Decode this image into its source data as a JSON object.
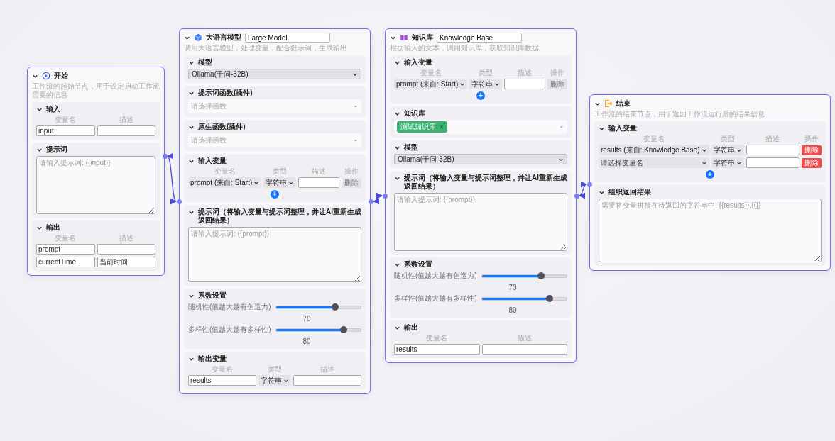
{
  "nodes": [
    {
      "kind": "start",
      "title": "开始",
      "description": "工作流的起始节点，用于设定启动工作流需要的信息",
      "sections": [
        {
          "kind": "vars",
          "title": "输入",
          "columns": [
            "变量名",
            "描述"
          ],
          "rows": [
            {
              "cells": [
                {
                  "kind": "input",
                  "value": "input"
                },
                {
                  "kind": "input"
                }
              ]
            }
          ]
        },
        {
          "kind": "textarea",
          "title": "提示词",
          "placeholder": "请输入提示词: {{input}}"
        },
        {
          "kind": "vars",
          "title": "输出",
          "columns": [
            "变量名",
            "描述"
          ],
          "rows": [
            {
              "cells": [
                {
                  "kind": "input",
                  "value": "prompt"
                },
                {
                  "kind": "input"
                }
              ]
            },
            {
              "cells": [
                {
                  "kind": "input",
                  "value": "currentTime"
                },
                {
                  "kind": "input",
                  "value": "当前时间"
                }
              ]
            }
          ]
        }
      ]
    },
    {
      "kind": "llm",
      "title": "大语言模型",
      "name_value": "Large Model",
      "description": "调用大语言模型，处理变量，配合提示词，生成输出",
      "sections": [
        {
          "kind": "select",
          "title": "模型",
          "value": "Ollama(千问-32B)"
        },
        {
          "kind": "picker",
          "title": "提示词函数(插件)",
          "placeholder": "请选择函数"
        },
        {
          "kind": "picker",
          "title": "原生函数(插件)",
          "placeholder": "请选择函数"
        },
        {
          "kind": "vars",
          "title": "输入变量",
          "columns": [
            "变量名",
            "类型",
            "描述",
            "操作"
          ],
          "rows": [
            {
              "cells": [
                {
                  "kind": "select",
                  "value": "prompt (来自: Start)"
                },
                {
                  "kind": "select",
                  "value": "字符串"
                },
                {
                  "kind": "input"
                },
                {
                  "kind": "button",
                  "label": "删除",
                  "disabled": true
                }
              ]
            }
          ],
          "add_button": "+"
        },
        {
          "kind": "textarea",
          "title": "提示词（将输入变量与提示词整理，并让AI重新生成返回结果）",
          "placeholder": "请输入提示词: {{prompt}}"
        },
        {
          "kind": "sliders",
          "title": "系数设置",
          "items": [
            {
              "label": "随机性(值越大越有创造力)",
              "level": 0.7,
              "reading": "70"
            },
            {
              "label": "多样性(值越大越有多样性)",
              "level": 0.8,
              "reading": "80"
            }
          ]
        },
        {
          "kind": "vars",
          "title": "输出变量",
          "columns": [
            "变量名",
            "类型",
            "描述"
          ],
          "rows": [
            {
              "cells": [
                {
                  "kind": "input",
                  "value": "results"
                },
                {
                  "kind": "select",
                  "value": "字符串"
                },
                {
                  "kind": "input"
                }
              ]
            }
          ]
        }
      ]
    },
    {
      "kind": "knowledge",
      "title": "知识库",
      "name_value": "Knowledge Base",
      "description": "根据输入的文本，调用知识库，获取知识库数据",
      "sections": [
        {
          "kind": "vars",
          "title": "输入变量",
          "columns": [
            "变量名",
            "类型",
            "描述",
            "操作"
          ],
          "rows": [
            {
              "cells": [
                {
                  "kind": "select",
                  "value": "prompt (来自: Start)"
                },
                {
                  "kind": "select",
                  "value": "字符串"
                },
                {
                  "kind": "input"
                },
                {
                  "kind": "button",
                  "label": "删除",
                  "disabled": true
                }
              ]
            }
          ],
          "add_button": "+"
        },
        {
          "kind": "picker",
          "title": "知识库",
          "tags": [
            {
              "label": "测试知识库",
              "close": "×"
            }
          ]
        },
        {
          "kind": "select",
          "title": "模型",
          "value": "Ollama(千问-32B)"
        },
        {
          "kind": "textarea",
          "title": "提示词（将输入变量与提示词整理，并让AI重新生成返回结果）",
          "placeholder": "请输入提示词: {{prompt}}"
        },
        {
          "kind": "sliders",
          "title": "系数设置",
          "items": [
            {
              "label": "随机性(值越大越有创造力)",
              "level": 0.7,
              "reading": "70"
            },
            {
              "label": "多样性(值越大越有多样性)",
              "level": 0.8,
              "reading": "80"
            }
          ]
        },
        {
          "kind": "vars",
          "title": "输出",
          "columns": [
            "变量名",
            "描述"
          ],
          "rows": [
            {
              "cells": [
                {
                  "kind": "input",
                  "value": "results"
                },
                {
                  "kind": "input"
                }
              ]
            }
          ]
        }
      ]
    },
    {
      "kind": "end",
      "title": "结束",
      "description": "工作流的结束节点，用于返回工作流运行后的结果信息",
      "sections": [
        {
          "kind": "vars",
          "title": "输入变量",
          "columns": [
            "变量名",
            "类型",
            "描述",
            "操作"
          ],
          "rows": [
            {
              "cells": [
                {
                  "kind": "select",
                  "value": "results (来自: Knowledge Base)"
                },
                {
                  "kind": "select",
                  "value": "字符串"
                },
                {
                  "kind": "input"
                },
                {
                  "kind": "button",
                  "label": "删除",
                  "disabled": false
                }
              ]
            },
            {
              "cells": [
                {
                  "kind": "select",
                  "placeholder": "请选择变量名"
                },
                {
                  "kind": "select",
                  "value": "字符串"
                },
                {
                  "kind": "input"
                },
                {
                  "kind": "button",
                  "label": "删除",
                  "disabled": false
                }
              ]
            }
          ],
          "add_button": "+"
        },
        {
          "kind": "textarea",
          "title": "组织返回结果",
          "placeholder": "需要将变量拼接在待返回的字符串中: {{results}},{{}}"
        }
      ]
    }
  ]
}
